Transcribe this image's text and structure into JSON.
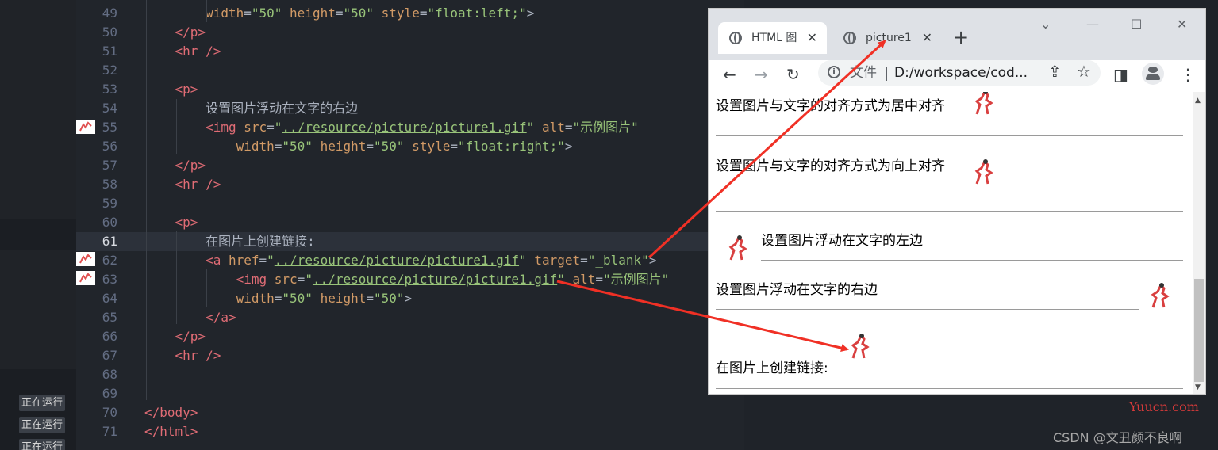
{
  "sidebar": {
    "running_label": "正在运行"
  },
  "editor": {
    "lines": [
      {
        "n": "49",
        "html": "        <span class=\"a\">width</span>=<span class=\"s\">\"50\"</span> <span class=\"a\">height</span>=<span class=\"s\">\"50\"</span> <span class=\"a\">style</span>=<span class=\"s\">\"float:left;\"</span>&gt;"
      },
      {
        "n": "50",
        "html": "    <span class=\"t\">&lt;/p&gt;</span>"
      },
      {
        "n": "51",
        "html": "    <span class=\"t\">&lt;hr /&gt;</span>"
      },
      {
        "n": "52",
        "html": ""
      },
      {
        "n": "53",
        "html": "    <span class=\"t\">&lt;p&gt;</span>"
      },
      {
        "n": "54",
        "html": "        设置图片浮动在文字的右边"
      },
      {
        "n": "55",
        "html": "        <span class=\"t\">&lt;img</span> <span class=\"a\">src</span>=<span class=\"s\">\"</span><span class=\"u\">../resource/picture/picture1.gif</span><span class=\"s\">\"</span> <span class=\"a\">alt</span>=<span class=\"s\">\"示例图片\"</span>"
      },
      {
        "n": "56",
        "html": "            <span class=\"a\">width</span>=<span class=\"s\">\"50\"</span> <span class=\"a\">height</span>=<span class=\"s\">\"50\"</span> <span class=\"a\">style</span>=<span class=\"s\">\"float:right;\"</span>&gt;"
      },
      {
        "n": "57",
        "html": "    <span class=\"t\">&lt;/p&gt;</span>"
      },
      {
        "n": "58",
        "html": "    <span class=\"t\">&lt;hr /&gt;</span>"
      },
      {
        "n": "59",
        "html": ""
      },
      {
        "n": "60",
        "html": "    <span class=\"t\">&lt;p&gt;</span>"
      },
      {
        "n": "61",
        "html": "        在图片上创建链接:"
      },
      {
        "n": "62",
        "html": "        <span class=\"t\">&lt;a</span> <span class=\"a\">href</span>=<span class=\"s\">\"</span><span class=\"u\">../resource/picture/picture1.gif</span><span class=\"s\">\"</span> <span class=\"a\">target</span>=<span class=\"s\">\"_blank\"</span>&gt;"
      },
      {
        "n": "63",
        "html": "            <span class=\"t\">&lt;img</span> <span class=\"a\">src</span>=<span class=\"s\">\"</span><span class=\"u\">../resource/picture/picture1.gif</span><span class=\"s\">\"</span> <span class=\"a\">alt</span>=<span class=\"s\">\"示例图片\"</span>"
      },
      {
        "n": "64",
        "html": "            <span class=\"a\">width</span>=<span class=\"s\">\"50\"</span> <span class=\"a\">height</span>=<span class=\"s\">\"50\"</span>&gt;"
      },
      {
        "n": "65",
        "html": "        <span class=\"t\">&lt;/a&gt;</span>"
      },
      {
        "n": "66",
        "html": "    <span class=\"t\">&lt;/p&gt;</span>"
      },
      {
        "n": "67",
        "html": "    <span class=\"t\">&lt;hr /&gt;</span>"
      },
      {
        "n": "68",
        "html": ""
      },
      {
        "n": "69",
        "html": ""
      },
      {
        "n": "70",
        "html": "<span class=\"t\">&lt;/body&gt;</span>"
      },
      {
        "n": "71",
        "html": "<span class=\"t\">&lt;/html&gt;</span>"
      }
    ],
    "current_line": "61"
  },
  "browser": {
    "tabs": [
      {
        "title": "HTML 图"
      },
      {
        "title": "picture1"
      }
    ],
    "new_tab": "+",
    "window_controls": {
      "chevron": "⌄",
      "minimize": "—",
      "maximize": "☐",
      "close": "✕"
    },
    "nav": {
      "back": "←",
      "forward": "→",
      "reload": "↻"
    },
    "address": {
      "label": "文件",
      "url": "D:/workspace/cod..."
    },
    "toolbar_icons": {
      "share": "⇪",
      "star": "☆",
      "sidepanel": "◨",
      "profile": "●",
      "menu": "⋮"
    },
    "page": {
      "line1": "设置图片与文字的对齐方式为居中对齐",
      "line2": "设置图片与文字的对齐方式为向上对齐",
      "line3": "设置图片浮动在文字的左边",
      "line4": "设置图片浮动在文字的右边",
      "line5": "在图片上创建链接:"
    }
  },
  "watermarks": {
    "yuucn": "Yuucn.com",
    "csdn": "CSDN @文丑颜不良啊"
  },
  "colors": {
    "arrow": "#f03025",
    "editor_bg": "#21252b"
  }
}
